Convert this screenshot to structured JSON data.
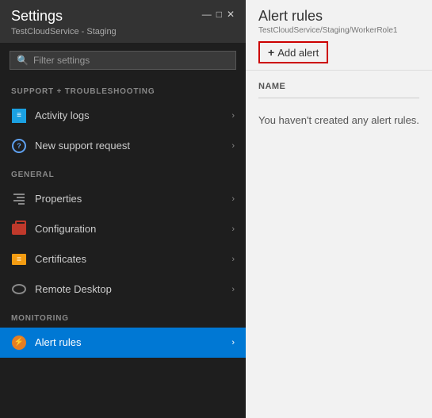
{
  "settings": {
    "title": "Settings",
    "subtitle": "TestCloudService - Staging",
    "window_controls": [
      "—",
      "□",
      "✕"
    ],
    "search_placeholder": "Filter settings",
    "sections": [
      {
        "label": "SUPPORT + TROUBLESHOOTING",
        "items": [
          {
            "id": "activity-logs",
            "label": "Activity logs",
            "icon": "activity",
            "active": false
          },
          {
            "id": "new-support-request",
            "label": "New support request",
            "icon": "support",
            "active": false
          }
        ]
      },
      {
        "label": "GENERAL",
        "items": [
          {
            "id": "properties",
            "label": "Properties",
            "icon": "properties",
            "active": false
          },
          {
            "id": "configuration",
            "label": "Configuration",
            "icon": "config",
            "active": false
          },
          {
            "id": "certificates",
            "label": "Certificates",
            "icon": "certs",
            "active": false
          },
          {
            "id": "remote-desktop",
            "label": "Remote Desktop",
            "icon": "remote",
            "active": false
          }
        ]
      },
      {
        "label": "MONITORING",
        "items": [
          {
            "id": "alert-rules",
            "label": "Alert rules",
            "icon": "alert",
            "active": true
          }
        ]
      }
    ]
  },
  "alert_rules": {
    "title": "Alert rules",
    "path": "TestCloudService/Staging/WorkerRole1",
    "add_button_label": "Add alert",
    "table_column_name": "NAME",
    "empty_message": "You haven't created any alert rules."
  }
}
